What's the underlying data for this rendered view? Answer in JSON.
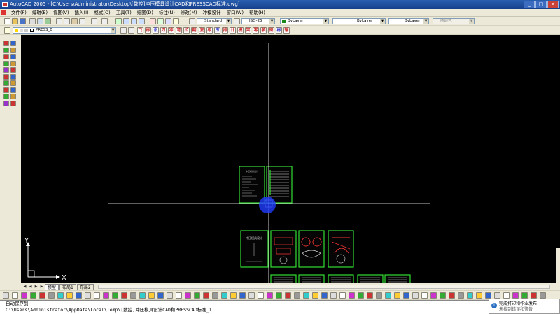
{
  "window": {
    "title": "AutoCAD 2005 - [C:\\Users\\Administrator\\Desktop\\[数控]冲压模具设计CAD和PRESSCAD标准.dwg]"
  },
  "window_buttons": {
    "minimize": "_",
    "maximize": "□",
    "close": "×"
  },
  "menu": [
    "文件(F)",
    "编辑(E)",
    "视图(V)",
    "插入(I)",
    "格式(O)",
    "工具(T)",
    "绘图(D)",
    "标注(N)",
    "修改(M)",
    "冲模设计",
    "窗口(W)",
    "帮助(H)"
  ],
  "toolbars": {
    "text_style": "Standard",
    "dim_style": "ISO-25",
    "color": "ByLayer",
    "linetype": "ByLayer",
    "lineweight": "ByLayer",
    "plot_style": "随颜色",
    "layer": "PRESS_0",
    "press_tools": [
      "飞",
      "标",
      "设",
      "刃",
      "冲",
      "弯",
      "拉",
      "翻",
      "复",
      "级",
      "压",
      "排",
      "计",
      "模",
      "架",
      "零",
      "装",
      "图",
      "标",
      "输"
    ]
  },
  "layout_tabs": [
    "模型",
    "布局1",
    "布局2"
  ],
  "nav_arrows": [
    "◀",
    "◀",
    "▶",
    "▶"
  ],
  "ucs": {
    "x_label": "X",
    "y_label": "Y"
  },
  "command_line": {
    "line1": "自动保存到",
    "line2": "C:\\Users\\Administrator\\AppData\\Local\\Temp\\[数控]冲压模具设计CAD和PRESSCAD标准_1"
  },
  "notification": {
    "icon": "i",
    "title": "完成打印和作业发布",
    "subtitle": "未找到错误和警告"
  },
  "colors": {
    "canvas": "#000000",
    "crosshair": "#ffffff",
    "sheet_border": "#33dd33",
    "cursor": "#2244ff",
    "toolbar": "#ece9d8"
  },
  "sheets": [
    {
      "title": "冲压模具设计",
      "kind": "text"
    },
    {
      "title": "",
      "kind": "text"
    },
    {
      "title": "冲压模具设计",
      "kind": "cover"
    },
    {
      "title": "",
      "kind": "drawing"
    },
    {
      "title": "",
      "kind": "drawing"
    },
    {
      "title": "",
      "kind": "drawing"
    },
    {
      "title": "",
      "kind": "table"
    },
    {
      "title": "",
      "kind": "table"
    },
    {
      "title": "",
      "kind": "table"
    },
    {
      "title": "",
      "kind": "table"
    },
    {
      "title": "",
      "kind": "table"
    }
  ]
}
